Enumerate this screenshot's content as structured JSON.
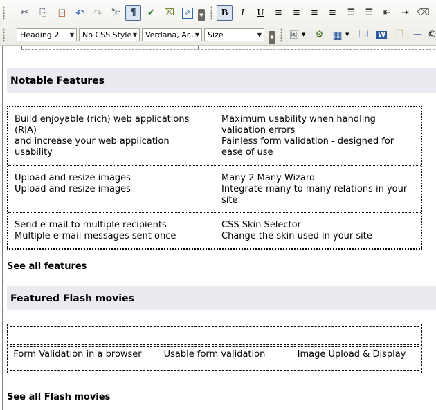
{
  "toolbar": {
    "row1": [
      {
        "name": "cut-icon",
        "glyph": "✂"
      },
      {
        "name": "copy-icon",
        "glyph": "⎘"
      },
      {
        "name": "paste-icon",
        "glyph": "📋"
      },
      {
        "name": "undo-icon",
        "glyph": "↶"
      },
      {
        "name": "redo-icon",
        "glyph": "↷"
      },
      {
        "name": "find-icon",
        "glyph": "🔭"
      },
      {
        "name": "paragraph-marks-icon",
        "glyph": "¶"
      },
      {
        "name": "spellcheck-icon",
        "glyph": "✔"
      },
      {
        "name": "clean-html-icon",
        "glyph": "⌧"
      },
      {
        "name": "insert-link-icon",
        "glyph": "⇗"
      },
      {
        "name": "bold-icon",
        "glyph": "B"
      },
      {
        "name": "italic-icon",
        "glyph": "I"
      },
      {
        "name": "underline-icon",
        "glyph": "U"
      },
      {
        "name": "align-left-icon",
        "glyph": "≡"
      },
      {
        "name": "align-center-icon",
        "glyph": "≡"
      },
      {
        "name": "align-right-icon",
        "glyph": "≡"
      },
      {
        "name": "justify-icon",
        "glyph": "≡"
      },
      {
        "name": "numbered-list-icon",
        "glyph": "☰"
      },
      {
        "name": "bulleted-list-icon",
        "glyph": "☰"
      },
      {
        "name": "outdent-icon",
        "glyph": "⇤"
      },
      {
        "name": "indent-icon",
        "glyph": "⇥"
      },
      {
        "name": "eraser-icon",
        "glyph": "⌫"
      }
    ],
    "paragraph_style": "Heading 2",
    "css_style": "No CSS Style",
    "font_name": "Verdana, Ar...",
    "font_size": "Size",
    "row2": [
      {
        "name": "insert-image-icon",
        "glyph": "🖼"
      },
      {
        "name": "flash-icon",
        "glyph": "⚙"
      },
      {
        "name": "insert-table-icon",
        "glyph": "▦"
      },
      {
        "name": "image-manager-icon",
        "glyph": "🗔"
      },
      {
        "name": "insert-document-icon",
        "glyph": "W"
      },
      {
        "name": "template-icon",
        "glyph": "🗋"
      },
      {
        "name": "horizontal-rule-icon",
        "glyph": "—"
      },
      {
        "name": "copyright-icon",
        "glyph": "©"
      }
    ]
  },
  "content": {
    "features": {
      "heading": "Notable Features",
      "rows": [
        [
          {
            "title": "Build enjoyable (rich) web applications (RIA)",
            "desc": "and increase your web application usability"
          },
          {
            "title": "Maximum usability when handling validation errors",
            "desc": "Painless form validation - designed for ease of use"
          }
        ],
        [
          {
            "title": "Upload and resize images",
            "desc": "Upload and resize images"
          },
          {
            "title": "Many 2 Many Wizard",
            "desc": "Integrate many to many relations in your site"
          }
        ],
        [
          {
            "title": "Send e-mail to multiple recipients",
            "desc": "Multiple e-mail messages sent once"
          },
          {
            "title": "CSS Skin Selector",
            "desc": "Change the skin used in your site"
          }
        ]
      ],
      "see_all": "See all features"
    },
    "flash": {
      "heading": "Featured Flash movies",
      "movies": [
        "Form Validation in a browser",
        "Usable form validation",
        "Image Upload & Display"
      ],
      "see_all": "See all Flash movies"
    }
  }
}
